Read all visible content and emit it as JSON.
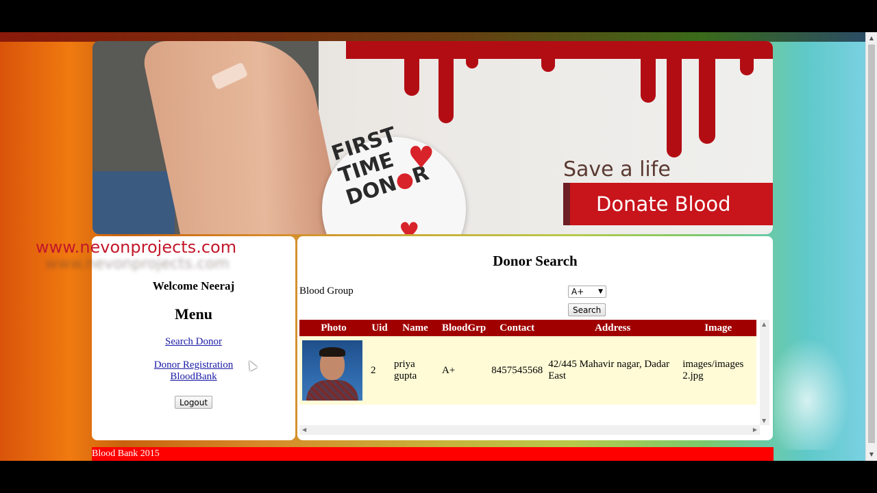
{
  "banner": {
    "badge_line1": "FIRST",
    "badge_line2": "TIME",
    "badge_line3": "DON",
    "badge_line3_end": "R",
    "tagline": "Save a life",
    "cta": "Donate Blood"
  },
  "watermark": "www.nevonprojects.com",
  "sidebar": {
    "welcome": "Welcome Neeraj",
    "menu_title": "Menu",
    "links": [
      "Search Donor",
      "Donor Registration",
      "BloodBank"
    ],
    "logout_label": "Logout"
  },
  "search": {
    "title": "Donor Search",
    "blood_group_label": "Blood Group",
    "blood_group_value": "A+",
    "search_label": "Search"
  },
  "results": {
    "columns": [
      "Photo",
      "Uid",
      "Name",
      "BloodGrp",
      "Contact",
      "Address",
      "Image"
    ],
    "rows": [
      {
        "photo": "donor-photo",
        "uid": "2",
        "name": "priya gupta",
        "bloodgrp": "A+",
        "contact": "8457545568",
        "address": "42/445 Mahavir nagar, Dadar East",
        "image": "images/images 2.jpg"
      }
    ]
  },
  "footer": {
    "text": "Blood Bank 2015"
  },
  "colors": {
    "header_row": "#a00000",
    "row_bg": "#fffbd6",
    "footer_bg": "#ff0000",
    "blood": "#b30d14"
  }
}
